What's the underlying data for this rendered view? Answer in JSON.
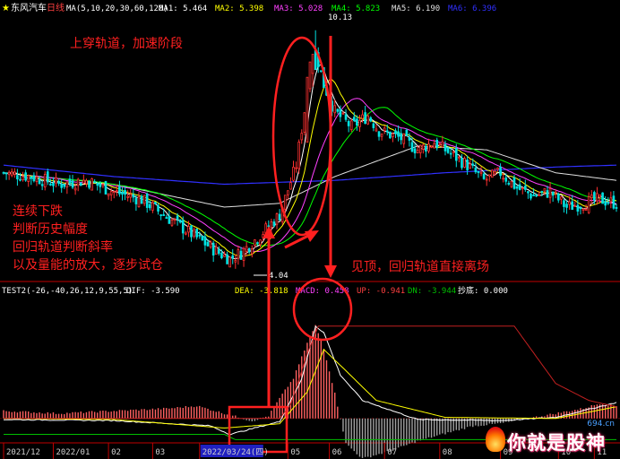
{
  "header": {
    "star": "★",
    "stock_name": "东风汽车",
    "period": "日线",
    "ma_label": "MA(5,10,20,30,60,120)",
    "ma1": "MA1: 5.464",
    "ma2": "MA2: 5.398",
    "ma3": "MA3: 5.028",
    "ma4": "MA4: 5.823",
    "ma5": "MA5: 6.190",
    "ma6": "MA6: 6.396"
  },
  "price_labels": {
    "high": "10.13",
    "low": "4.04"
  },
  "annotations": {
    "top": "上穿轨道，加速阶段",
    "left": [
      "连续下跌",
      "判断历史幅度",
      "回归轨道判断斜率",
      "以及量能的放大，逐步试仓"
    ],
    "right": "见顶，回归轨道直接离场"
  },
  "indicator_header": {
    "name": "TEST2(-26,-40,26,12,9,55,5)",
    "dif": "DIF: -3.590",
    "dea": "DEA: -3.818",
    "macd": "MACD: 0.458",
    "up": "UP: -0.941",
    "dn": "DN: -3.944",
    "bottom": "抄底: 0.000"
  },
  "x_axis": {
    "labels": [
      {
        "text": "2021/12",
        "day": 0
      },
      {
        "text": "2022/01",
        "day": 18
      },
      {
        "text": "02",
        "day": 38
      },
      {
        "text": "03",
        "day": 54
      },
      {
        "text": "2022/03/24(四)",
        "day": 71
      },
      {
        "text": "05",
        "day": 103
      },
      {
        "text": "06",
        "day": 118
      },
      {
        "text": "07",
        "day": 138
      },
      {
        "text": "08",
        "day": 158
      },
      {
        "text": "09",
        "day": 180
      },
      {
        "text": "10",
        "day": 201
      },
      {
        "text": "11",
        "day": 214
      }
    ]
  },
  "watermark": {
    "text": "你就是股神",
    "site": "694.cn"
  },
  "colors": {
    "up": "#ff3030",
    "down": "#00e0e0",
    "ma5": "#ffffff",
    "ma10": "#ffff00",
    "ma20": "#ff40ff",
    "ma30": "#00ff00",
    "ma60": "#e0e0e0",
    "ma120": "#3030ff",
    "dif": "#ffffff",
    "dea": "#ffff00",
    "up_band": "#c02020",
    "dn_band": "#00c000",
    "annotation": "#ff2020",
    "axis": "#c00000"
  },
  "chart_data": [
    {
      "type": "candlestick",
      "title": "东风汽车 日线",
      "ylim": [
        3.6,
        10.5
      ],
      "series_keypoints": {
        "close": [
          [
            0,
            6.4
          ],
          [
            10,
            6.3
          ],
          [
            20,
            6.1
          ],
          [
            30,
            6.2
          ],
          [
            40,
            5.9
          ],
          [
            50,
            5.7
          ],
          [
            58,
            5.3
          ],
          [
            64,
            5.0
          ],
          [
            70,
            4.7
          ],
          [
            78,
            4.3
          ],
          [
            82,
            4.15
          ],
          [
            86,
            4.3
          ],
          [
            92,
            4.7
          ],
          [
            100,
            5.3
          ],
          [
            106,
            6.6
          ],
          [
            110,
            8.5
          ],
          [
            113,
            9.6
          ],
          [
            116,
            8.7
          ],
          [
            120,
            8.0
          ],
          [
            126,
            7.6
          ],
          [
            132,
            7.9
          ],
          [
            136,
            7.5
          ],
          [
            144,
            7.3
          ],
          [
            150,
            7.0
          ],
          [
            156,
            7.2
          ],
          [
            162,
            6.9
          ],
          [
            168,
            6.6
          ],
          [
            174,
            6.2
          ],
          [
            180,
            6.4
          ],
          [
            186,
            6.0
          ],
          [
            192,
            5.8
          ],
          [
            198,
            5.9
          ],
          [
            204,
            5.5
          ],
          [
            210,
            5.6
          ],
          [
            216,
            5.7
          ],
          [
            222,
            5.6
          ]
        ],
        "ma120": [
          [
            0,
            6.6
          ],
          [
            40,
            6.3
          ],
          [
            80,
            6.1
          ],
          [
            120,
            6.2
          ],
          [
            160,
            6.4
          ],
          [
            200,
            6.55
          ],
          [
            222,
            6.6
          ]
        ],
        "ma60": [
          [
            0,
            6.4
          ],
          [
            40,
            6.1
          ],
          [
            80,
            5.5
          ],
          [
            100,
            5.6
          ],
          [
            120,
            6.3
          ],
          [
            150,
            7.1
          ],
          [
            175,
            7.0
          ],
          [
            200,
            6.4
          ],
          [
            222,
            6.2
          ]
        ]
      },
      "labels": {
        "high": 10.13,
        "low": 4.04
      }
    },
    {
      "type": "macd_histogram",
      "title": "TEST2(-26,-40,26,12,9,55,5)",
      "ylim": [
        -5.0,
        1.8
      ],
      "series": [
        {
          "name": "DIF",
          "keypoints": [
            [
              0,
              -3.9
            ],
            [
              40,
              -3.95
            ],
            [
              75,
              -4.2
            ],
            [
              82,
              -4.6
            ],
            [
              100,
              -4.0
            ],
            [
              108,
              -2.0
            ],
            [
              113,
              0.5
            ],
            [
              116,
              0.2
            ],
            [
              122,
              -1.8
            ],
            [
              130,
              -3.0
            ],
            [
              150,
              -3.9
            ],
            [
              180,
              -3.95
            ],
            [
              200,
              -3.8
            ],
            [
              222,
              -3.1
            ]
          ]
        },
        {
          "name": "DEA",
          "keypoints": [
            [
              0,
              -3.85
            ],
            [
              40,
              -3.9
            ],
            [
              80,
              -4.3
            ],
            [
              100,
              -4.1
            ],
            [
              110,
              -2.6
            ],
            [
              116,
              -0.6
            ],
            [
              124,
              -1.6
            ],
            [
              135,
              -3.0
            ],
            [
              160,
              -3.8
            ],
            [
              200,
              -3.85
            ],
            [
              222,
              -3.3
            ]
          ]
        },
        {
          "name": "UP",
          "keypoints": [
            [
              0,
              -3.85
            ],
            [
              100,
              -3.85
            ],
            [
              104,
              -3.2
            ],
            [
              110,
              -0.8
            ],
            [
              114,
              0.5
            ],
            [
              118,
              0.5
            ],
            [
              185,
              0.5
            ],
            [
              200,
              -2.2
            ],
            [
              212,
              -3.0
            ],
            [
              222,
              -3.3
            ]
          ]
        },
        {
          "name": "DN",
          "keypoints": [
            [
              0,
              -4.6
            ],
            [
              80,
              -4.6
            ],
            [
              84,
              -4.85
            ],
            [
              100,
              -4.85
            ],
            [
              222,
              -4.85
            ]
          ]
        }
      ],
      "histogram_keypoints": [
        [
          0,
          0.3
        ],
        [
          20,
          0.2
        ],
        [
          40,
          0.3
        ],
        [
          60,
          0.4
        ],
        [
          70,
          0.5
        ],
        [
          80,
          0.2
        ],
        [
          90,
          -0.1
        ],
        [
          96,
          0.1
        ],
        [
          100,
          0.8
        ],
        [
          105,
          1.6
        ],
        [
          110,
          3.0
        ],
        [
          113,
          3.7
        ],
        [
          116,
          2.8
        ],
        [
          120,
          1.0
        ],
        [
          124,
          -1.0
        ],
        [
          130,
          -1.6
        ],
        [
          140,
          -1.3
        ],
        [
          150,
          -0.9
        ],
        [
          160,
          -0.6
        ],
        [
          170,
          -0.3
        ],
        [
          180,
          -0.2
        ],
        [
          190,
          0.0
        ],
        [
          200,
          0.2
        ],
        [
          210,
          0.4
        ],
        [
          216,
          0.6
        ],
        [
          222,
          0.5
        ]
      ]
    }
  ]
}
